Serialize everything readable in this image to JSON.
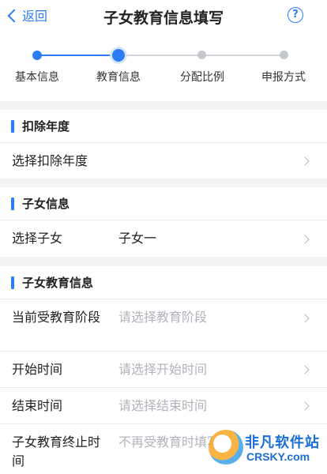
{
  "header": {
    "back_label": "返回",
    "title": "子女教育信息填写",
    "help_symbol": "?"
  },
  "steps": [
    {
      "label": "基本信息",
      "state": "done"
    },
    {
      "label": "教育信息",
      "state": "current"
    },
    {
      "label": "分配比例",
      "state": "todo"
    },
    {
      "label": "申报方式",
      "state": "todo"
    }
  ],
  "sections": {
    "deduction_year": {
      "title": "扣除年度",
      "row_label": "选择扣除年度",
      "row_value": ""
    },
    "child_info": {
      "title": "子女信息",
      "row_label": "选择子女",
      "row_value": "子女一"
    },
    "education_info": {
      "title": "子女教育信息",
      "stage_label": "当前受教育阶段",
      "stage_placeholder": "请选择教育阶段",
      "start_label": "开始时间",
      "start_placeholder": "请选择开始时间",
      "end_label": "结束时间",
      "end_placeholder": "请选择结束时间",
      "termination_label": "子女教育终止时间",
      "termination_placeholder": "不再受教育时填写"
    }
  },
  "watermark": {
    "title": "非凡软件站",
    "subtitle": "CRSKY.com"
  },
  "colors": {
    "accent": "#2d7cf6",
    "placeholder": "#b0b3b9",
    "background": "#f2f3f5"
  }
}
